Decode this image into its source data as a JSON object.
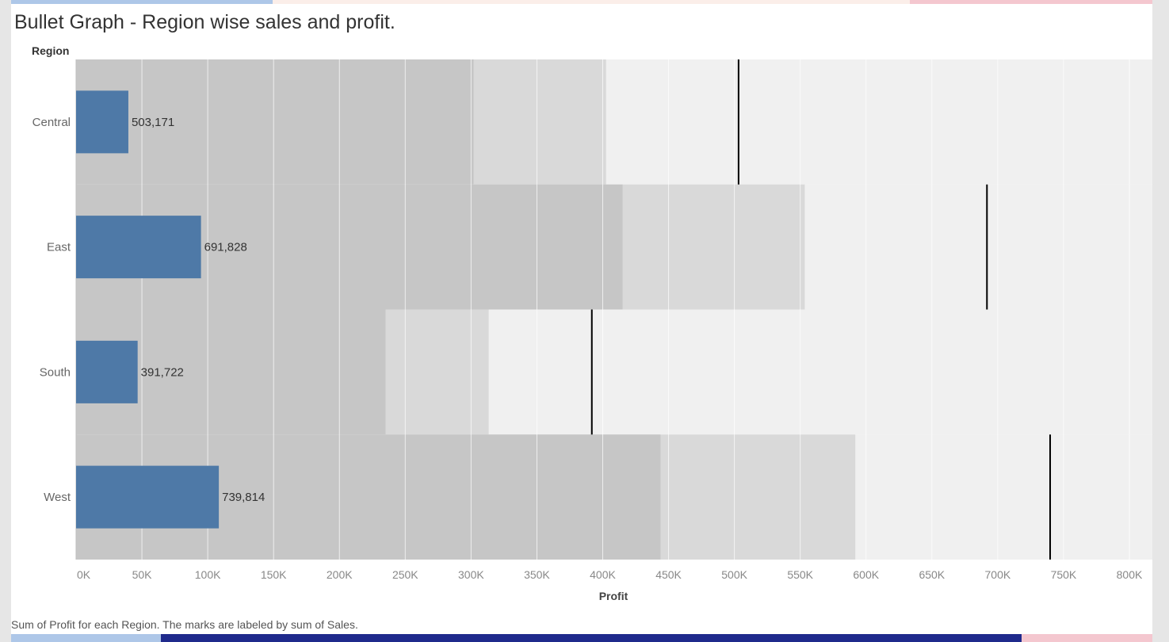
{
  "page": {
    "title": "Bullet Graph - Region wise sales and profit.",
    "caption": "Sum of Profit for each Region.  The marks are labeled by sum of Sales."
  },
  "colors": {
    "bar": "#4e79a7",
    "band_dark": "#c6c6c6",
    "band_mid": "#d9d9d9",
    "band_light": "#f0f0f0",
    "reference_line": "#000000",
    "gridline": "#ffffff",
    "strip_blue_light": "#aec7e8",
    "strip_blue_dark": "#1f2a8c",
    "strip_pink": "#f4c7cf",
    "strip_peach": "#fbeee9"
  },
  "chart_data": {
    "type": "bar",
    "orientation": "horizontal",
    "variant": "bullet",
    "title": "Bullet Graph - Region wise sales and profit.",
    "ylabel": "Region",
    "xlabel": "Profit",
    "xlim": [
      0,
      800000
    ],
    "x_ticks": [
      0,
      50000,
      100000,
      150000,
      200000,
      250000,
      300000,
      350000,
      400000,
      450000,
      500000,
      550000,
      600000,
      650000,
      700000,
      750000,
      800000
    ],
    "x_tick_labels": [
      "0K",
      "50K",
      "100K",
      "150K",
      "200K",
      "250K",
      "300K",
      "350K",
      "400K",
      "450K",
      "500K",
      "550K",
      "600K",
      "650K",
      "700K",
      "750K",
      "800K"
    ],
    "vertical_grid": true,
    "categories": [
      "Central",
      "East",
      "South",
      "West"
    ],
    "series": [
      {
        "values": [
          39706,
          94883,
          46749,
          108418
        ]
      }
    ],
    "data_labels": [
      "503,171",
      "691,828",
      "391,722",
      "739,814"
    ],
    "reference_lines": [
      503171,
      691828,
      391722,
      739814
    ],
    "bands": [
      {
        "dark": 301903,
        "mid": 402537,
        "light": 800000
      },
      {
        "dark": 415097,
        "mid": 553462,
        "light": 800000
      },
      {
        "dark": 235033,
        "mid": 313378,
        "light": 800000
      },
      {
        "dark": 443888,
        "mid": 591851,
        "light": 800000
      }
    ]
  }
}
